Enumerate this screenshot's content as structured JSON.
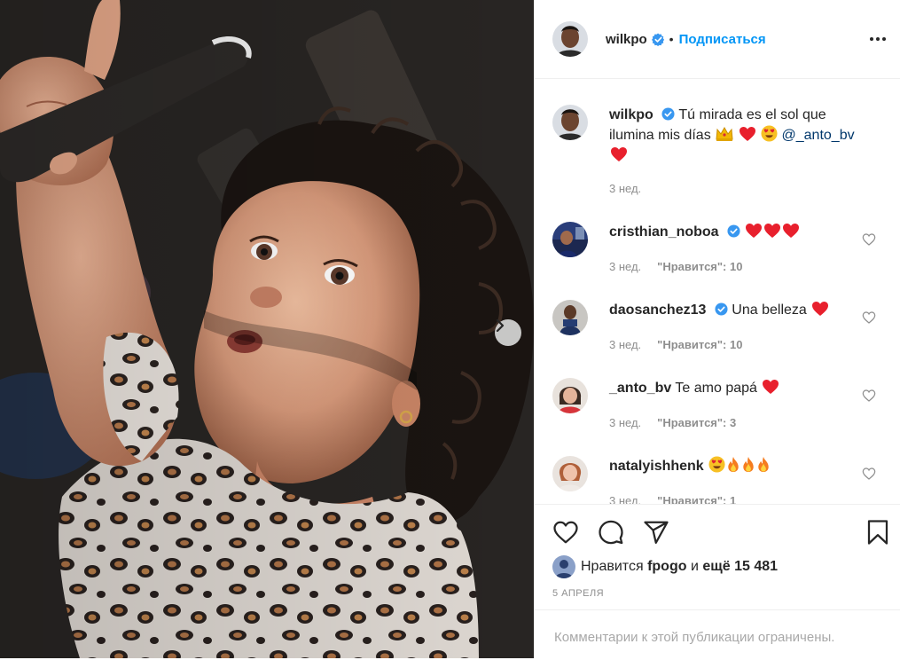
{
  "post": {
    "author": "wilkpo",
    "follow_label": "Подписаться",
    "separator": "•",
    "caption_text": "Tú mirada es el sol que ilumina mis días",
    "caption_mention": "@_anto_bv",
    "caption_time": "3 нед.",
    "likes_prefix": "Нравится",
    "likes_user": "fpogo",
    "likes_and": "и",
    "likes_rest": "ещё 15 481",
    "date": "5 апреля",
    "comments_restricted": "Комментарии к этой публикации ограничены."
  },
  "comments": [
    {
      "user": "cristhian_noboa",
      "verified": true,
      "text": "",
      "emoji": [
        "heart",
        "heart",
        "heart"
      ],
      "time": "3 нед.",
      "likes": "\"Нравится\": 10"
    },
    {
      "user": "daosanchez13",
      "verified": true,
      "text": "Una belleza",
      "emoji": [
        "heart"
      ],
      "time": "3 нед.",
      "likes": "\"Нравится\": 10"
    },
    {
      "user": "_anto_bv",
      "verified": false,
      "text": "Te amo papá",
      "emoji": [
        "heart"
      ],
      "time": "3 нед.",
      "likes": "\"Нравится\": 3"
    },
    {
      "user": "natalyishhenk",
      "verified": false,
      "text": "",
      "emoji": [
        "heart-eyes",
        "fire",
        "fire",
        "fire"
      ],
      "time": "3 нед.",
      "likes": "\"Нравится\": 1"
    }
  ],
  "colors": {
    "accent": "#0095f6",
    "text": "#262626",
    "muted": "#8e8e8e",
    "heart": "#ed4956",
    "verified": "#3897f0"
  },
  "icons": [
    "verified-badge-icon",
    "more-options-icon",
    "heart-icon",
    "comment-icon",
    "share-icon",
    "bookmark-icon",
    "chevron-right-icon",
    "crown-emoji",
    "heart-emoji",
    "heart-eyes-emoji",
    "fire-emoji"
  ]
}
